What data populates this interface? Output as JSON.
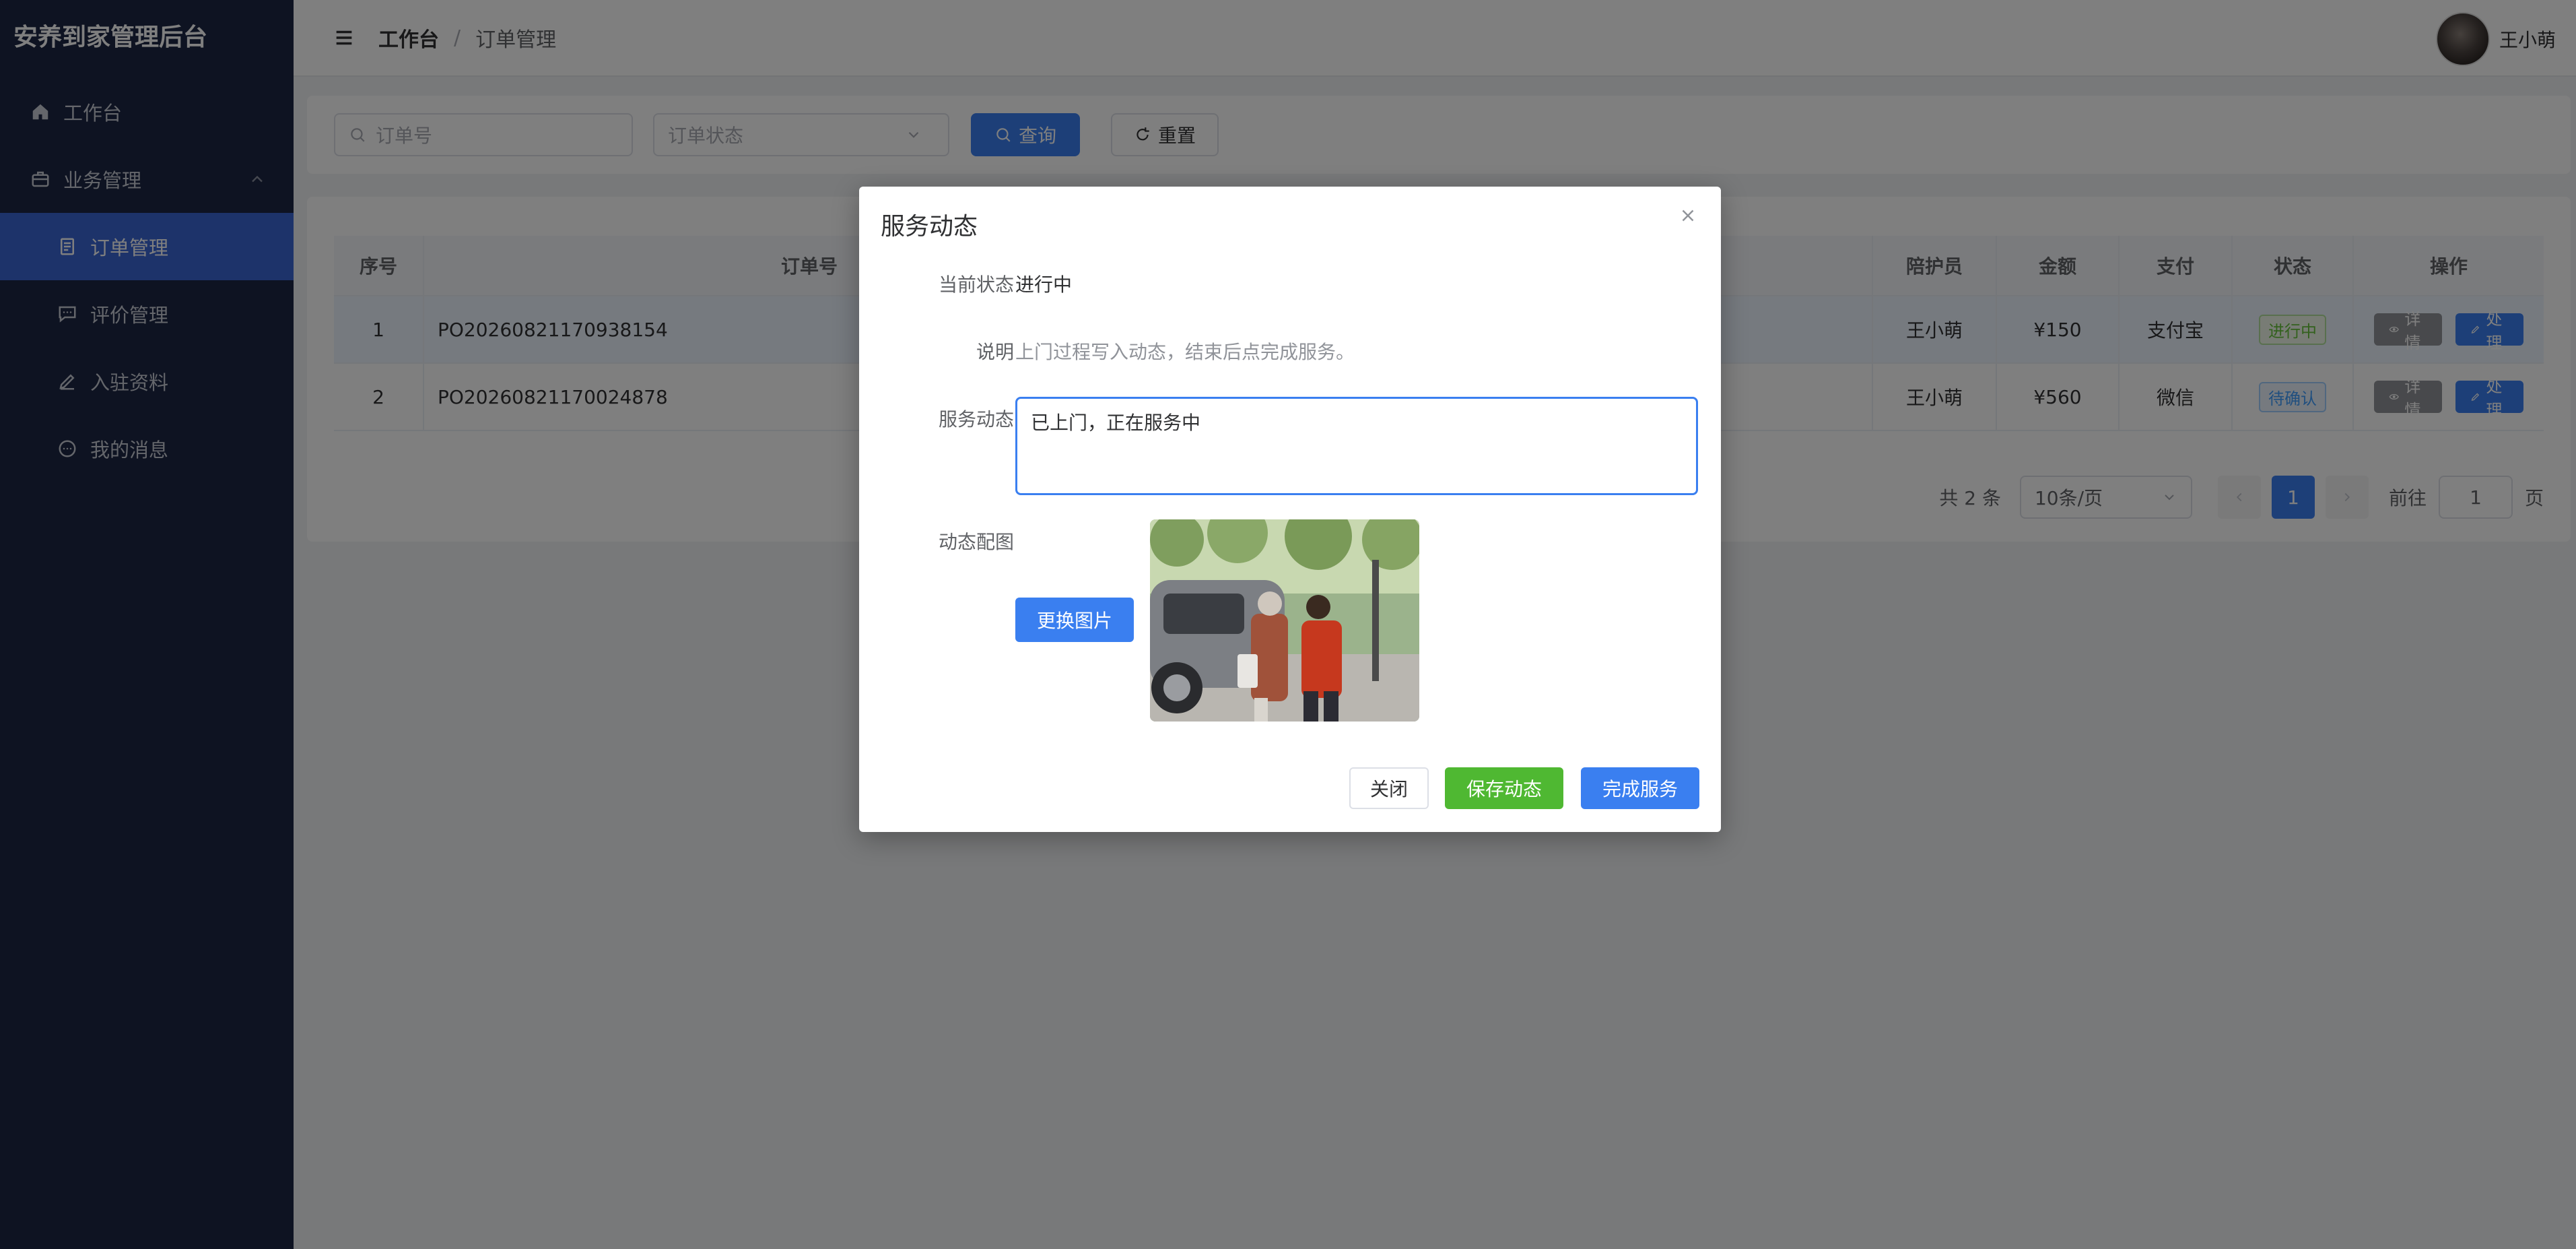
{
  "app": {
    "title": "安养到家管理后台"
  },
  "sidebar": {
    "items": [
      {
        "label": "工作台"
      },
      {
        "label": "业务管理"
      },
      {
        "label": "订单管理"
      },
      {
        "label": "评价管理"
      },
      {
        "label": "入驻资料"
      },
      {
        "label": "我的消息"
      }
    ]
  },
  "header": {
    "breadcrumb": [
      "工作台",
      "订单管理"
    ],
    "separator": "/",
    "user_name": "王小萌"
  },
  "search": {
    "order_placeholder": "订单号",
    "status_placeholder": "订单状态",
    "query_label": "查询",
    "reset_label": "重置"
  },
  "table": {
    "columns": [
      "序号",
      "订单号",
      "陪护员",
      "金额",
      "支付",
      "状态",
      "操作"
    ],
    "rows": [
      {
        "index": "1",
        "order_no": "PO20260821170938154",
        "caregiver": "王小萌",
        "amount": "¥150",
        "pay": "支付宝",
        "status": "进行中"
      },
      {
        "index": "2",
        "order_no": "PO20260821170024878",
        "caregiver": "王小萌",
        "amount": "¥560",
        "pay": "微信",
        "status": "待确认"
      }
    ],
    "detail_label": "详情",
    "process_label": "处理"
  },
  "pagination": {
    "total": "共 2 条",
    "page_size": "10条/页",
    "current": "1",
    "goto_prefix": "前往",
    "goto_value": "1",
    "goto_suffix": "页"
  },
  "dialog": {
    "title": "服务动态",
    "status_label": "当前状态",
    "status_value": "进行中",
    "desc_label": "说明",
    "desc_value": "上门过程写入动态，结束后点完成服务。",
    "dynamic_label": "服务动态",
    "dynamic_value": "已上门，正在服务中",
    "image_label": "动态配图",
    "replace_label": "更换图片",
    "close_label": "关闭",
    "save_label": "保存动态",
    "done_label": "完成服务"
  },
  "colors": {
    "primary": "#3a7ff0",
    "sidebar": "#1d2744",
    "success": "#4fb832"
  }
}
